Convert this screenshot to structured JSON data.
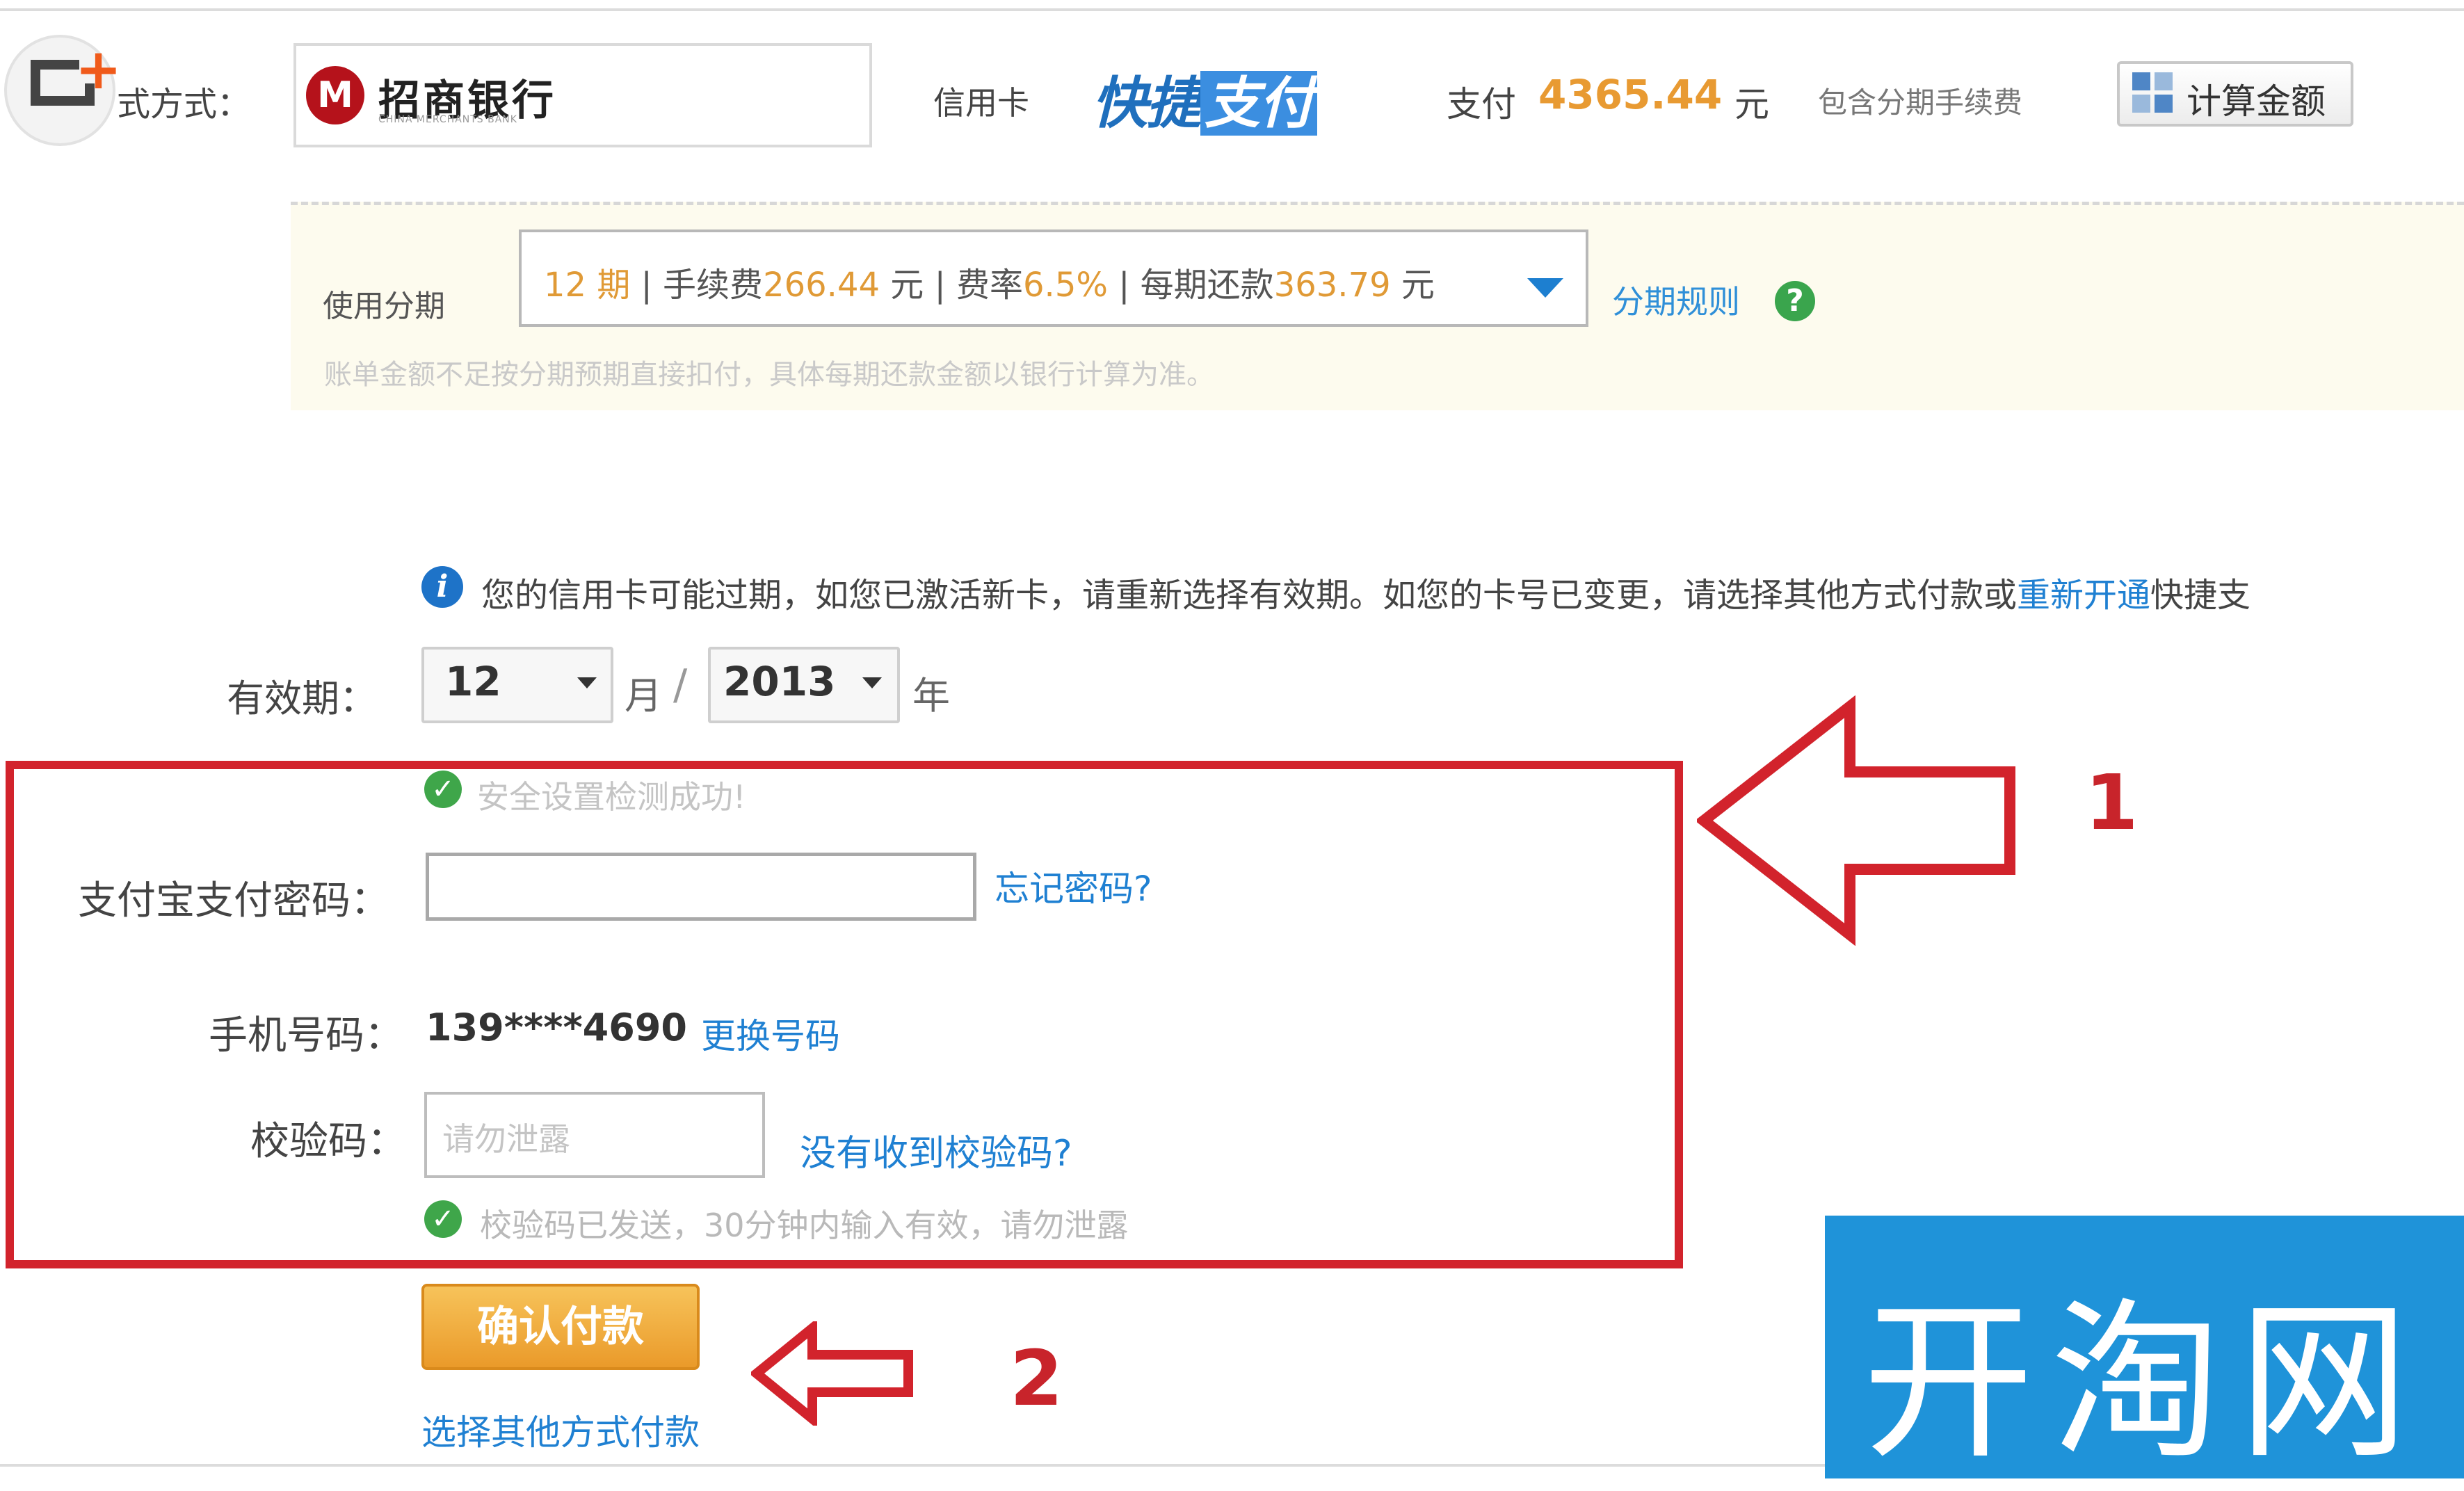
{
  "header": {
    "pay_method_label": "式方式：",
    "bank_name": "招商银行",
    "bank_sub": "CHINA MERCHANTS BANK",
    "card_type": "信用卡",
    "quickpay_a": "快捷",
    "quickpay_b": "支付",
    "pay_prefix": "支付",
    "pay_amount": "4365.44",
    "pay_unit": "元",
    "fee_note": "包含分期手续费",
    "calc_label": "计算金额"
  },
  "installment": {
    "label": "使用分期",
    "period": "12 期",
    "fee_label": "手续费",
    "fee_value": "266.44",
    "fee_unit": "元",
    "rate_label": "费率",
    "rate_value": "6.5%",
    "per_label": "每期还款",
    "per_value": "363.79",
    "per_unit": "元",
    "help_label": "分期规则",
    "note": "账单金额不足按分期预期直接扣付，具体每期还款金额以银行计算为准。"
  },
  "notice": {
    "text": "您的信用卡可能过期，如您已激活新卡，请重新选择有效期。如您的卡号已变更，请选择其他方式付款或",
    "link": "重新开通",
    "tail": "快捷支"
  },
  "expiry": {
    "label": "有效期：",
    "month": "12",
    "month_unit": "月",
    "slash": "/",
    "year": "2013",
    "year_unit": "年"
  },
  "form": {
    "security_ok": "安全设置检测成功!",
    "pwd_label": "支付宝支付密码：",
    "pwd_forgot": "忘记密码?",
    "phone_label": "手机号码：",
    "phone_value": "139****4690",
    "phone_change": "更换号码",
    "code_label": "校验码：",
    "code_placeholder": "请勿泄露",
    "code_none": "没有收到校验码?",
    "code_sent": "校验码已发送，30分钟内输入有效，请勿泄露"
  },
  "actions": {
    "confirm": "确认付款",
    "other_pay": "选择其他方式付款"
  },
  "annotations": {
    "num1": "1",
    "num2": "2"
  },
  "watermark": {
    "text": "开淘网"
  },
  "colors": {
    "annotation_red": "#d2232c",
    "link_blue": "#1f80d2",
    "amount_orange": "#e89a32",
    "watermark_blue": "#1f93d9"
  }
}
